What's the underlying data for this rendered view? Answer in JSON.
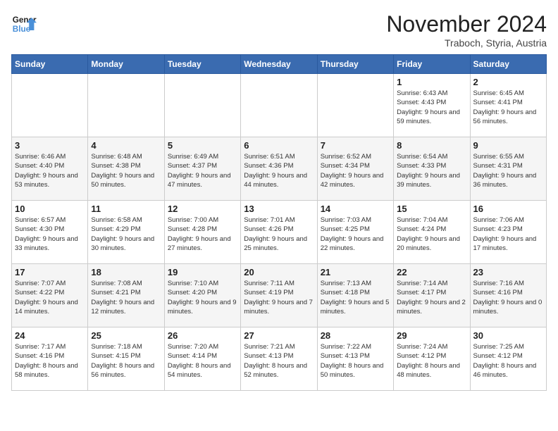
{
  "header": {
    "logo_general": "General",
    "logo_blue": "Blue",
    "month": "November 2024",
    "location": "Traboch, Styria, Austria"
  },
  "days_of_week": [
    "Sunday",
    "Monday",
    "Tuesday",
    "Wednesday",
    "Thursday",
    "Friday",
    "Saturday"
  ],
  "weeks": [
    [
      {
        "day": "",
        "info": ""
      },
      {
        "day": "",
        "info": ""
      },
      {
        "day": "",
        "info": ""
      },
      {
        "day": "",
        "info": ""
      },
      {
        "day": "",
        "info": ""
      },
      {
        "day": "1",
        "info": "Sunrise: 6:43 AM\nSunset: 4:43 PM\nDaylight: 9 hours and 59 minutes."
      },
      {
        "day": "2",
        "info": "Sunrise: 6:45 AM\nSunset: 4:41 PM\nDaylight: 9 hours and 56 minutes."
      }
    ],
    [
      {
        "day": "3",
        "info": "Sunrise: 6:46 AM\nSunset: 4:40 PM\nDaylight: 9 hours and 53 minutes."
      },
      {
        "day": "4",
        "info": "Sunrise: 6:48 AM\nSunset: 4:38 PM\nDaylight: 9 hours and 50 minutes."
      },
      {
        "day": "5",
        "info": "Sunrise: 6:49 AM\nSunset: 4:37 PM\nDaylight: 9 hours and 47 minutes."
      },
      {
        "day": "6",
        "info": "Sunrise: 6:51 AM\nSunset: 4:36 PM\nDaylight: 9 hours and 44 minutes."
      },
      {
        "day": "7",
        "info": "Sunrise: 6:52 AM\nSunset: 4:34 PM\nDaylight: 9 hours and 42 minutes."
      },
      {
        "day": "8",
        "info": "Sunrise: 6:54 AM\nSunset: 4:33 PM\nDaylight: 9 hours and 39 minutes."
      },
      {
        "day": "9",
        "info": "Sunrise: 6:55 AM\nSunset: 4:31 PM\nDaylight: 9 hours and 36 minutes."
      }
    ],
    [
      {
        "day": "10",
        "info": "Sunrise: 6:57 AM\nSunset: 4:30 PM\nDaylight: 9 hours and 33 minutes."
      },
      {
        "day": "11",
        "info": "Sunrise: 6:58 AM\nSunset: 4:29 PM\nDaylight: 9 hours and 30 minutes."
      },
      {
        "day": "12",
        "info": "Sunrise: 7:00 AM\nSunset: 4:28 PM\nDaylight: 9 hours and 27 minutes."
      },
      {
        "day": "13",
        "info": "Sunrise: 7:01 AM\nSunset: 4:26 PM\nDaylight: 9 hours and 25 minutes."
      },
      {
        "day": "14",
        "info": "Sunrise: 7:03 AM\nSunset: 4:25 PM\nDaylight: 9 hours and 22 minutes."
      },
      {
        "day": "15",
        "info": "Sunrise: 7:04 AM\nSunset: 4:24 PM\nDaylight: 9 hours and 20 minutes."
      },
      {
        "day": "16",
        "info": "Sunrise: 7:06 AM\nSunset: 4:23 PM\nDaylight: 9 hours and 17 minutes."
      }
    ],
    [
      {
        "day": "17",
        "info": "Sunrise: 7:07 AM\nSunset: 4:22 PM\nDaylight: 9 hours and 14 minutes."
      },
      {
        "day": "18",
        "info": "Sunrise: 7:08 AM\nSunset: 4:21 PM\nDaylight: 9 hours and 12 minutes."
      },
      {
        "day": "19",
        "info": "Sunrise: 7:10 AM\nSunset: 4:20 PM\nDaylight: 9 hours and 9 minutes."
      },
      {
        "day": "20",
        "info": "Sunrise: 7:11 AM\nSunset: 4:19 PM\nDaylight: 9 hours and 7 minutes."
      },
      {
        "day": "21",
        "info": "Sunrise: 7:13 AM\nSunset: 4:18 PM\nDaylight: 9 hours and 5 minutes."
      },
      {
        "day": "22",
        "info": "Sunrise: 7:14 AM\nSunset: 4:17 PM\nDaylight: 9 hours and 2 minutes."
      },
      {
        "day": "23",
        "info": "Sunrise: 7:16 AM\nSunset: 4:16 PM\nDaylight: 9 hours and 0 minutes."
      }
    ],
    [
      {
        "day": "24",
        "info": "Sunrise: 7:17 AM\nSunset: 4:16 PM\nDaylight: 8 hours and 58 minutes."
      },
      {
        "day": "25",
        "info": "Sunrise: 7:18 AM\nSunset: 4:15 PM\nDaylight: 8 hours and 56 minutes."
      },
      {
        "day": "26",
        "info": "Sunrise: 7:20 AM\nSunset: 4:14 PM\nDaylight: 8 hours and 54 minutes."
      },
      {
        "day": "27",
        "info": "Sunrise: 7:21 AM\nSunset: 4:13 PM\nDaylight: 8 hours and 52 minutes."
      },
      {
        "day": "28",
        "info": "Sunrise: 7:22 AM\nSunset: 4:13 PM\nDaylight: 8 hours and 50 minutes."
      },
      {
        "day": "29",
        "info": "Sunrise: 7:24 AM\nSunset: 4:12 PM\nDaylight: 8 hours and 48 minutes."
      },
      {
        "day": "30",
        "info": "Sunrise: 7:25 AM\nSunset: 4:12 PM\nDaylight: 8 hours and 46 minutes."
      }
    ]
  ]
}
